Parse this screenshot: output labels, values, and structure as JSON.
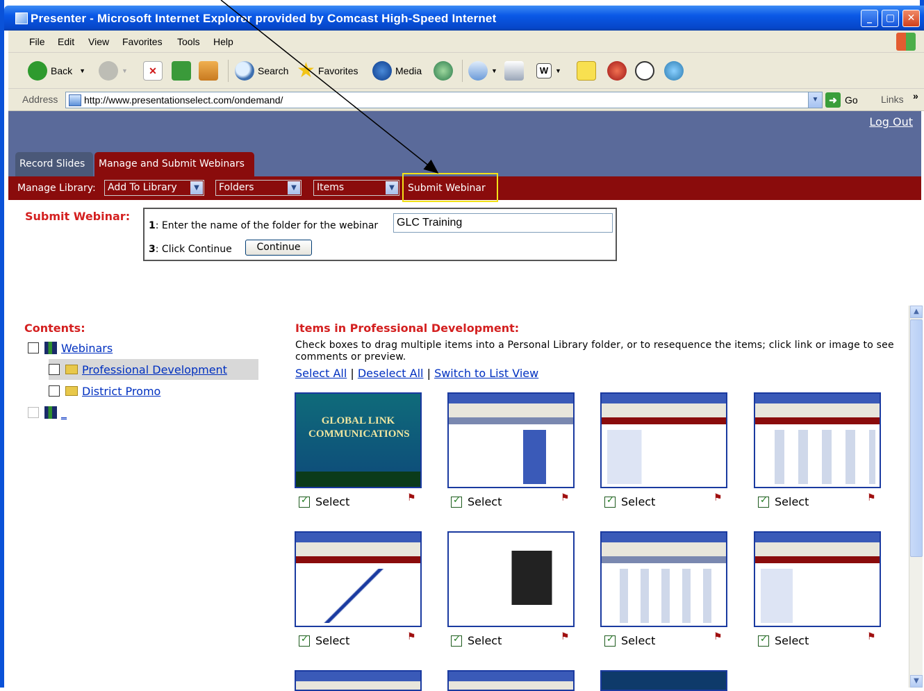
{
  "window": {
    "title": "Presenter - Microsoft Internet Explorer provided by Comcast High-Speed Internet"
  },
  "menu": [
    "File",
    "Edit",
    "View",
    "Favorites",
    "Tools",
    "Help"
  ],
  "toolbar": {
    "back": "Back",
    "search": "Search",
    "favorites": "Favorites",
    "media": "Media"
  },
  "address": {
    "label": "Address",
    "url": "http://www.presentationselect.com/ondemand/",
    "go": "Go",
    "links": "Links",
    "more": "»"
  },
  "header": {
    "logout": "Log Out",
    "tabs": [
      "Record Slides",
      "Manage and Submit Webinars"
    ]
  },
  "nav": {
    "label": "Manage Library:",
    "selects": [
      "Add To Library",
      "Folders",
      "Items"
    ],
    "submit": "Submit Webinar"
  },
  "form": {
    "heading": "Submit Webinar:",
    "step1_num": "1",
    "step1_text": ": Enter the name of the folder for the webinar",
    "folder_value": "GLC Training",
    "step3_num": "3",
    "step3_text": ": Click Continue",
    "continue": "Continue"
  },
  "contents": {
    "heading": "Contents:",
    "items": [
      {
        "label": "Webinars",
        "checked": false
      },
      {
        "label": "Professional Development",
        "checked": false,
        "selected": true
      },
      {
        "label": "District Promo",
        "checked": false
      },
      {
        "label": "_",
        "checked": false
      }
    ]
  },
  "items": {
    "heading": "Items in Professional Development:",
    "description": "Check boxes to drag multiple items into a Personal Library folder, or to resequence the items; click link or image to see comments or preview.",
    "select_all": "Select All",
    "deselect_all": "Deselect All",
    "switch_view": "Switch to List View",
    "separator": "|",
    "select_label": "Select",
    "thumb1_title": "Global Link Communications",
    "thumbs": [
      "slide-1",
      "slide-2",
      "slide-3",
      "slide-4",
      "slide-5",
      "slide-6",
      "slide-7",
      "slide-8"
    ]
  },
  "colors": {
    "header": "#5a6a9a",
    "nav": "#8a0c0c",
    "accent_red": "#d42020",
    "highlight": "#f2e218"
  }
}
